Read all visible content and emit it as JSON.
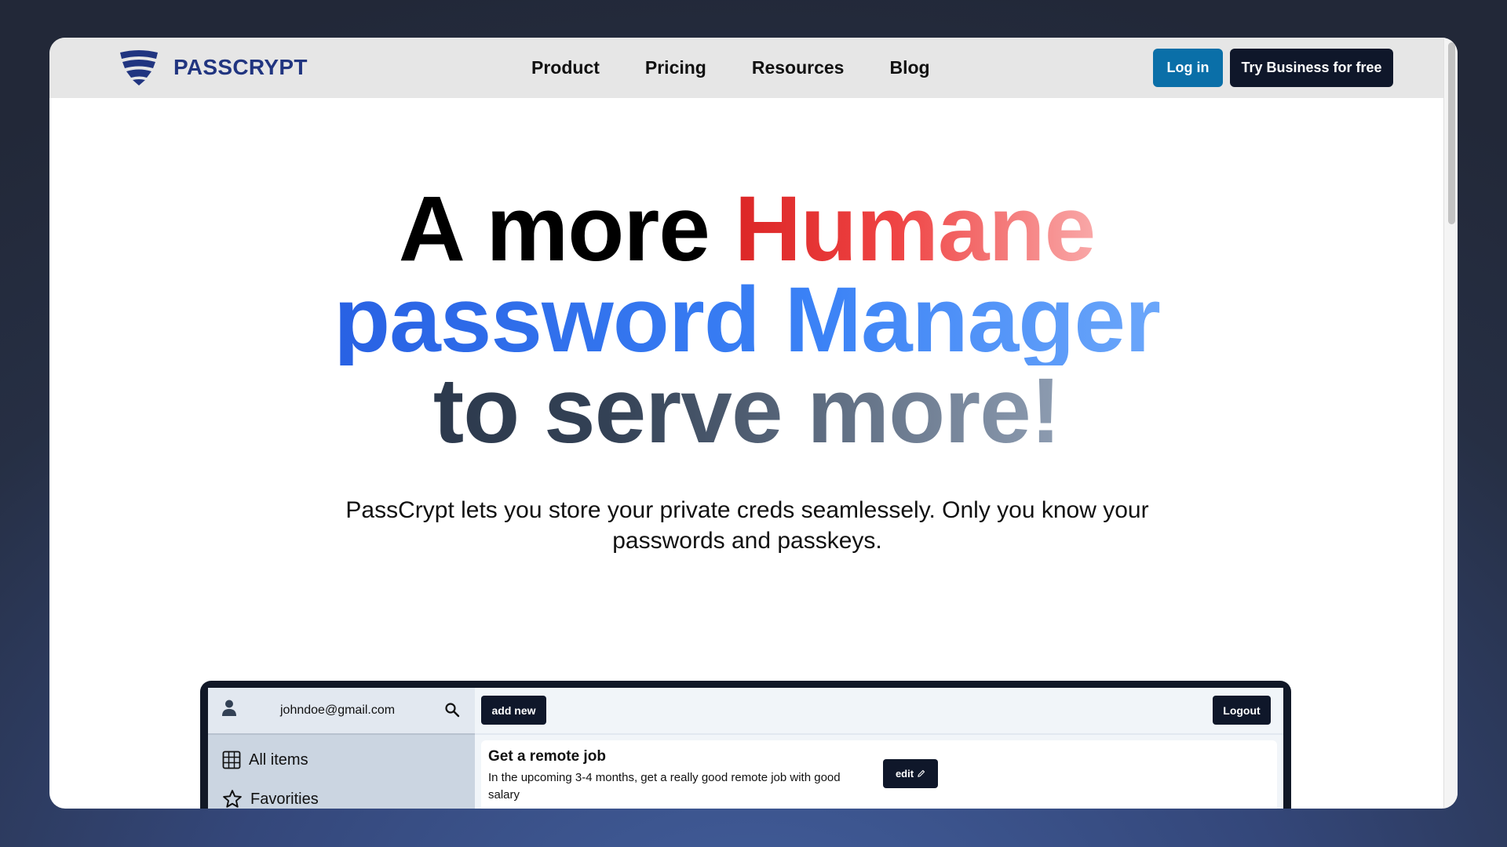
{
  "nav": {
    "logo_text": "PASSCRYPT",
    "links": [
      "Product",
      "Pricing",
      "Resources",
      "Blog"
    ],
    "login_label": "Log in",
    "business_label": "Try Business for free"
  },
  "hero": {
    "line1_a": "A more ",
    "line1_b": "Humane",
    "line2": "password Manager",
    "line3": "to serve more!",
    "subtitle": "PassCrypt lets you store your private creds seamlessely. Only you know your passwords and passkeys."
  },
  "app_preview": {
    "user_email": "johndoe@gmail.com",
    "add_new_label": "add new",
    "logout_label": "Logout",
    "sidebar_items": [
      {
        "label": "All items",
        "icon": "grid-icon"
      },
      {
        "label": "Favorities",
        "icon": "star-icon"
      }
    ],
    "card": {
      "title": "Get a remote job",
      "description": "In the upcoming 3-4 months, get a really good remote job with good salary",
      "edit_label": "edit"
    }
  },
  "colors": {
    "brand": "#213580",
    "login_button": "#0a6fa8",
    "dark_button": "#0f172a",
    "hero_red": "#dc2626",
    "hero_blue": "#2563eb",
    "hero_slate": "#1e293b"
  }
}
